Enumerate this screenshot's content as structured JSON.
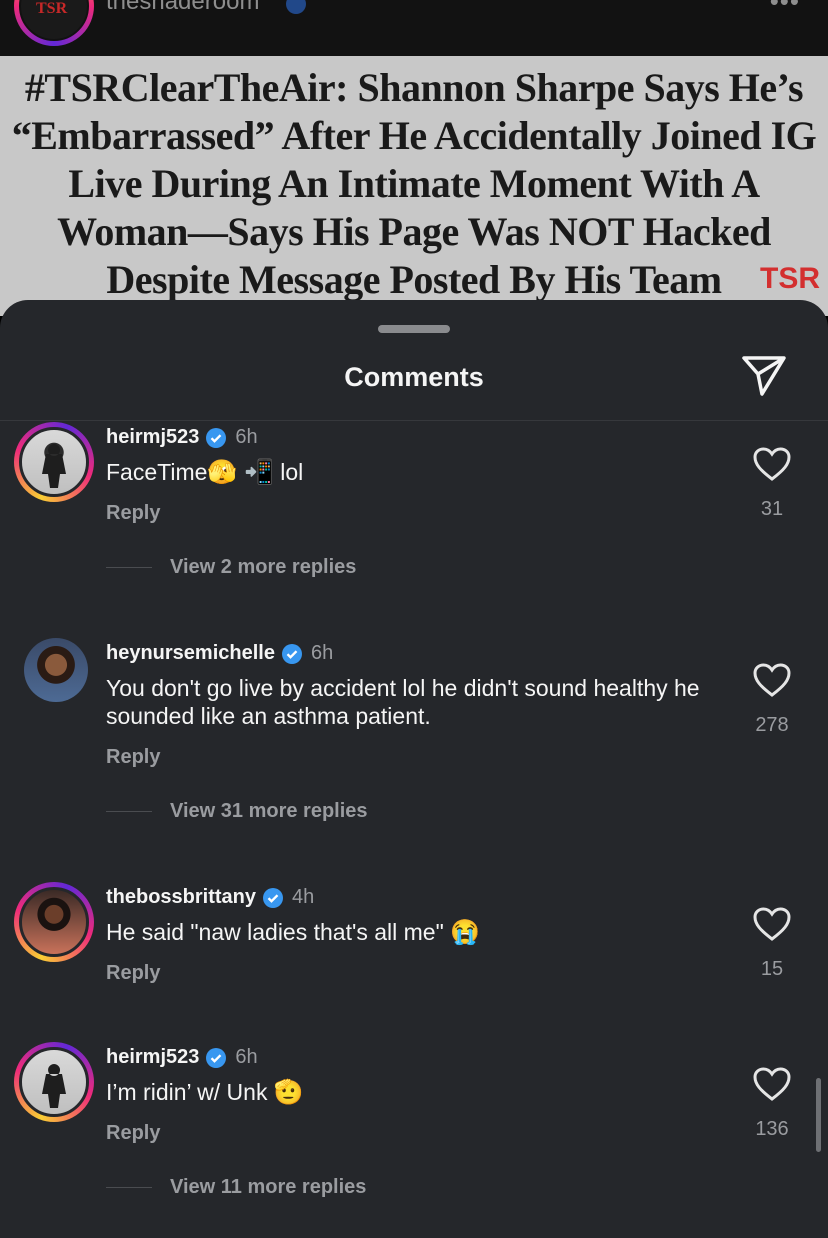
{
  "post": {
    "username": "theshaderoom",
    "more_label": "•••",
    "logo_text": "TSR",
    "headline": "#TSRClearTheAir: Shannon Sharpe Says He’s “Embarrassed” After He Accidentally Joined IG Live During An Intimate Moment With A Woman—Says His Page Was NOT Hacked Despite Message Posted By His Team",
    "watermark": "TSR"
  },
  "sheet": {
    "title": "Comments"
  },
  "comments": [
    {
      "username": "heirmj523",
      "time": "6h",
      "text": "FaceTime",
      "emoji": "🫣 📲",
      "text_after": "lol",
      "reply_label": "Reply",
      "likes": "31",
      "view_replies": "View 2 more replies"
    },
    {
      "username": "heynursemichelle",
      "time": "6h",
      "text": "You don't go live by accident lol he didn't sound healthy he sounded like an asthma patient.",
      "reply_label": "Reply",
      "likes": "278",
      "view_replies": "View 31 more replies"
    },
    {
      "username": "thebossbrittany",
      "time": "4h",
      "text": "He said \"naw ladies that's all me\"",
      "emoji": "😭",
      "reply_label": "Reply",
      "likes": "15"
    },
    {
      "username": "heirmj523",
      "time": "6h",
      "text": "I’m ridin’ w/ Unk",
      "emoji": "🫡",
      "reply_label": "Reply",
      "likes": "136",
      "view_replies": "View 11 more replies"
    }
  ],
  "colors": {
    "sheet_bg": "#25272b",
    "verified": "#3897f0",
    "muted": "#9a9ca0"
  }
}
